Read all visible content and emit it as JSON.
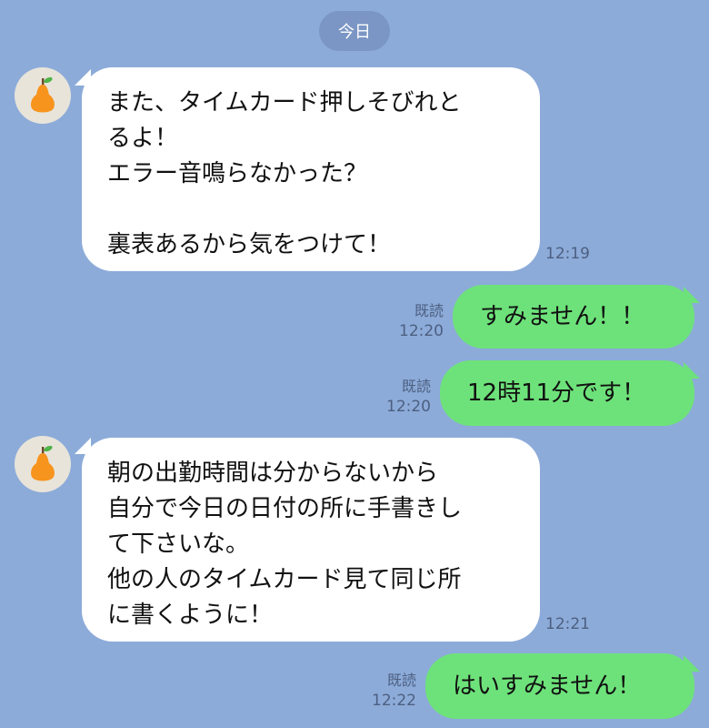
{
  "colors": {
    "background": "#8cabd9",
    "incoming_bubble": "#ffffff",
    "outgoing_bubble": "#6de27a",
    "date_pill": "#7b96c4"
  },
  "date_label": "今日",
  "avatar_icon": "pear-icon",
  "messages": [
    {
      "direction": "in",
      "text": "また、タイムカード押しそびれと\nるよ！\nエラー音鳴らなかった？\n\n裏表あるから気をつけて！",
      "time": "12:19"
    },
    {
      "direction": "out",
      "text": "すみません！！",
      "read": "既読",
      "time": "12:20"
    },
    {
      "direction": "out",
      "text": "12時11分です！",
      "read": "既読",
      "time": "12:20"
    },
    {
      "direction": "in",
      "text": "朝の出勤時間は分からないから\n自分で今日の日付の所に手書きし\nて下さいな。\n他の人のタイムカード見て同じ所\nに書くように！",
      "time": "12:21"
    },
    {
      "direction": "out",
      "text": "はいすみません！",
      "read": "既読",
      "time": "12:22"
    }
  ]
}
